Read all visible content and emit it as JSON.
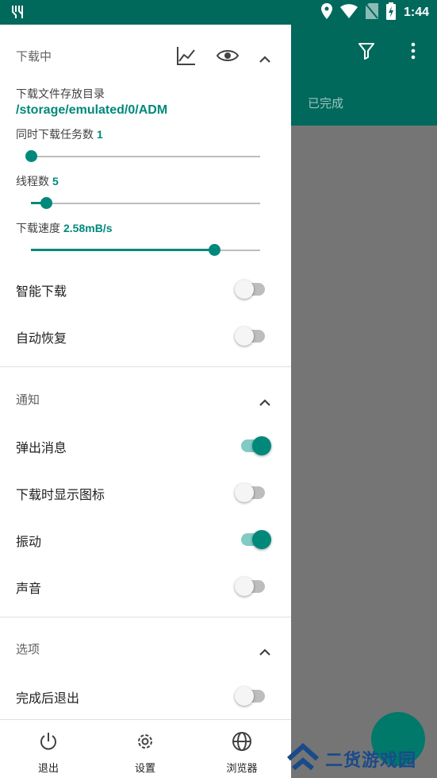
{
  "status_bar": {
    "time": "1:44"
  },
  "app": {
    "tab_completed": "已完成",
    "icons": [
      "filter-icon",
      "more-vert-icon"
    ]
  },
  "download_section": {
    "title": "下载中",
    "icons": [
      "chart-icon",
      "eye-icon",
      "chevron-up-icon"
    ],
    "dir_label": "下载文件存放目录",
    "dir_value": "/storage/emulated/0/ADM",
    "concurrent_label": "同时下载任务数",
    "concurrent_value": "1",
    "concurrent_fraction": 0.0,
    "threads_label": "线程数",
    "threads_value": "5",
    "threads_fraction": 0.065,
    "speed_label": "下载速度",
    "speed_value": "2.58mB/s",
    "speed_fraction": 0.8,
    "smart_download": {
      "label": "智能下载",
      "on": false
    },
    "auto_resume": {
      "label": "自动恢复",
      "on": false
    }
  },
  "notify_section": {
    "title": "通知",
    "popup": {
      "label": "弹出消息",
      "on": true
    },
    "show_icon": {
      "label": "下载时显示图标",
      "on": false
    },
    "vibrate": {
      "label": "振动",
      "on": true
    },
    "sound": {
      "label": "声音",
      "on": false
    }
  },
  "options_section": {
    "title": "选项",
    "exit_after": {
      "label": "完成后退出",
      "on": false
    }
  },
  "bottom_nav": {
    "exit": "退出",
    "settings": "设置",
    "browser": "浏览器"
  },
  "watermark": {
    "text": "二货游戏园"
  },
  "colors": {
    "primary_dark": "#00695c",
    "accent": "#00897b"
  }
}
